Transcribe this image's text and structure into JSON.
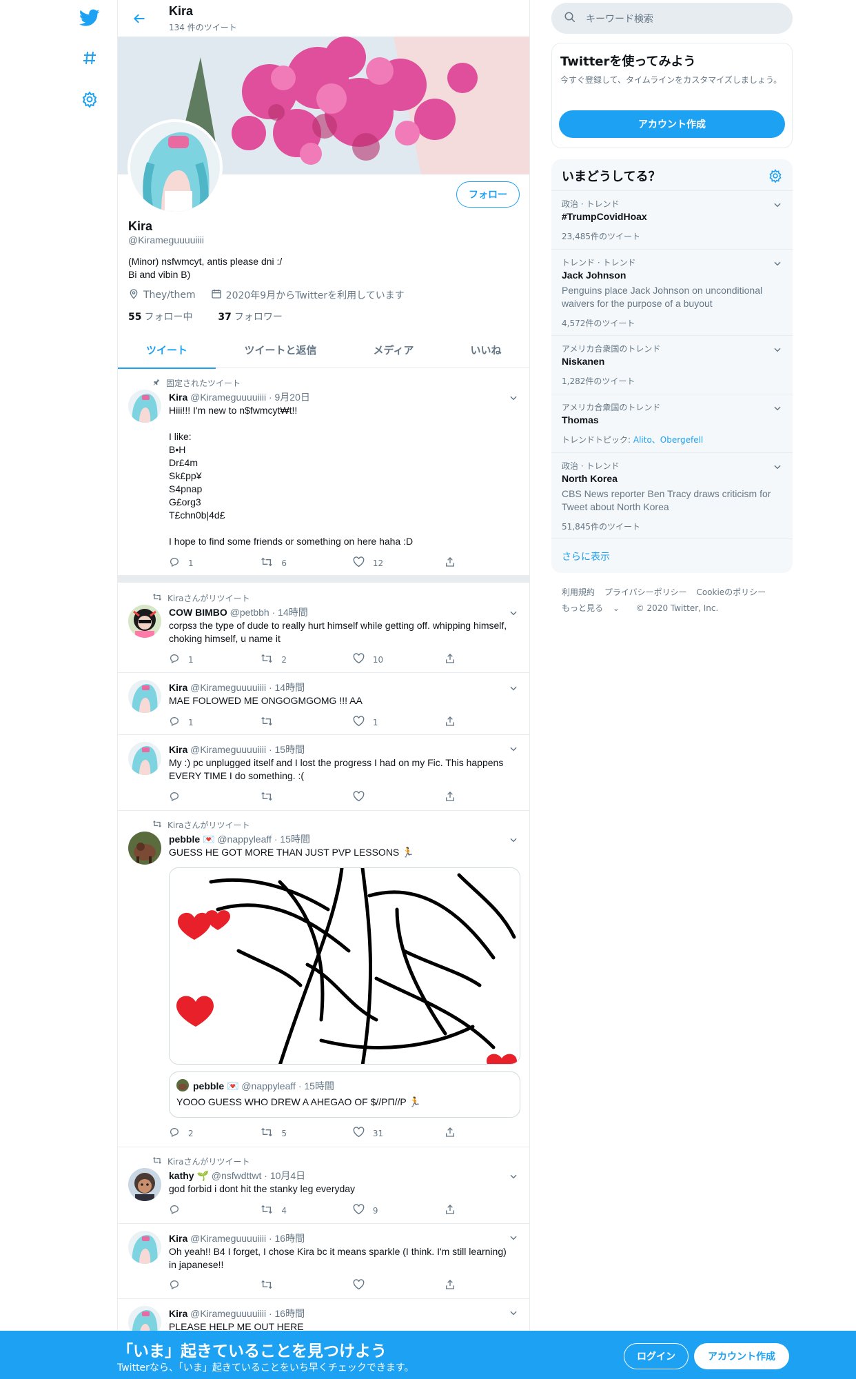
{
  "header": {
    "name": "Kira",
    "tweet_count": "134 件のツイート"
  },
  "profile": {
    "name": "Kira",
    "handle": "@Kirameguuuuiiii",
    "bio_line1": "(Minor) nsfwmcyt, antis please dni :/",
    "bio_line2": "Bi and vibin B)",
    "pronouns": "They/them",
    "joined": "2020年9月からTwitterを利用しています",
    "following_count": "55",
    "following_label": "フォロー中",
    "followers_count": "37",
    "followers_label": "フォロワー",
    "follow_button": "フォロー"
  },
  "tabs": [
    "ツイート",
    "ツイートと返信",
    "メディア",
    "いいね"
  ],
  "tweets": [
    {
      "context": "固定されたツイート",
      "name": "Kira",
      "handle": "@Kirameguuuuiiii",
      "time": "9月20日",
      "text": "Hiii!!! I'm new to n$fwmcyt₩t!!\n\nI like:\nB•H\nDr£4m\nSk£pp¥\nS4pnap\nG£org3\nT£chn0b|4d£\n\nI hope to find some friends or something on here haha :D",
      "replies": "1",
      "retweets": "6",
      "likes": "12"
    },
    {
      "context": "Kiraさんがリツイート",
      "name": "COW BIMBO",
      "handle": "@petbbh",
      "time": "14時間",
      "text": "corpsз the type of dude to really hurt himself while getting off. whipping himself, choking himself, u name it",
      "replies": "1",
      "retweets": "2",
      "likes": "10"
    },
    {
      "name": "Kira",
      "handle": "@Kirameguuuuiiii",
      "time": "14時間",
      "text": "MAE FOLOWED ME ONGOGMGOMG !!! AA",
      "replies": "1",
      "retweets": "",
      "likes": "1"
    },
    {
      "name": "Kira",
      "handle": "@Kirameguuuuiiii",
      "time": "15時間",
      "text": "My :) pc unplugged itself and I lost the progress I had on my Fic. This happens EVERY TIME I do something. :(",
      "replies": "",
      "retweets": "",
      "likes": ""
    },
    {
      "context": "Kiraさんがリツイート",
      "name": "pebble 💌",
      "handle": "@nappyleaff",
      "time": "15時間",
      "text": "GUESS HE GOT MORE THAN JUST PVP LESSONS 🏃",
      "quote_name": "pebble 💌",
      "quote_handle": "@nappyleaff",
      "quote_time": "15時間",
      "quote_text": "YOOO GUESS WHO DREW A AHEGAO OF $//PΠ//P 🏃",
      "replies": "2",
      "retweets": "5",
      "likes": "31"
    },
    {
      "context": "Kiraさんがリツイート",
      "name": "kathy 🌱",
      "handle": "@nsfwdttwt",
      "time": "10月4日",
      "text": "god forbid i dont hit the stanky leg everyday",
      "replies": "",
      "retweets": "4",
      "likes": "9"
    },
    {
      "name": "Kira",
      "handle": "@Kirameguuuuiiii",
      "time": "16時間",
      "text": "Oh yeah!! B4 I forget, I chose Kira bc it means sparkle (I think. I'm still learning) in japanese!!",
      "replies": "",
      "retweets": "",
      "likes": ""
    },
    {
      "name": "Kira",
      "handle": "@Kirameguuuuiiii",
      "time": "16時間",
      "text": "PLEASE HELP ME OUT HERE"
    }
  ],
  "search": {
    "placeholder": "キーワード検索"
  },
  "signup": {
    "title": "Twitterを使ってみよう",
    "desc": "今すぐ登録して、タイムラインをカスタマイズしましょう。",
    "button": "アカウント作成"
  },
  "trends": {
    "title": "いまどうしてる？",
    "items": [
      {
        "context": "政治 · トレンド",
        "title": "#TrumpCovidHoax",
        "desc": "",
        "count": "23,485件のツイート"
      },
      {
        "context": "トレンド · トレンド",
        "title": "Jack Johnson",
        "desc": "Penguins place Jack Johnson on unconditional waivers for the purpose of a buyout",
        "count": "4,572件のツイート"
      },
      {
        "context": "アメリカ合衆国のトレンド",
        "title": "Niskanen",
        "desc": "",
        "count": "1,282件のツイート"
      },
      {
        "context": "アメリカ合衆国のトレンド",
        "title": "Thomas",
        "desc": "",
        "count": "",
        "topics_label": "トレンドトピック:",
        "topics": "Alito、Obergefell"
      },
      {
        "context": "政治 · トレンド",
        "title": "North Korea",
        "desc": "CBS News reporter Ben Tracy draws criticism for Tweet about North Korea",
        "count": "51,845件のツイート"
      }
    ],
    "more": "さらに表示"
  },
  "footer": {
    "terms": "利用規約",
    "privacy": "プライバシーポリシー",
    "cookies": "Cookieのポリシー",
    "more": "もっと見る",
    "copyright": "© 2020 Twitter, Inc."
  },
  "bottombar": {
    "title": "「いま」起きていることを見つけよう",
    "subtitle": "Twitterなら、「いま」起きていることをいち早くチェックできます。",
    "login": "ログイン",
    "signup": "アカウント作成"
  },
  "colors": {
    "accent": "#1da1f2",
    "text": "#0f1419",
    "muted": "#657786",
    "border": "#e6ecf0"
  }
}
